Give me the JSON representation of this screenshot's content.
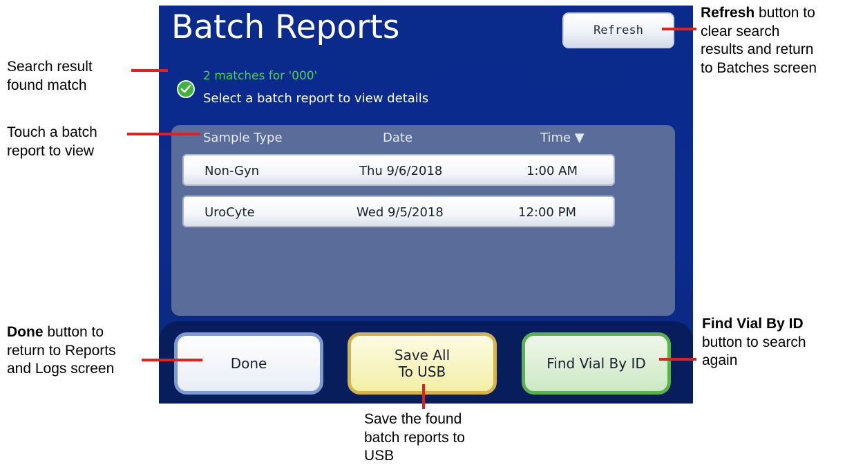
{
  "screen": {
    "title": "Batch Reports",
    "refresh_label": "Refresh",
    "match_text": "2 matches for '000'",
    "instruction": "Select a batch report to view details",
    "columns": {
      "sample_type": "Sample Type",
      "date": "Date",
      "time": "Time ▼"
    },
    "rows": [
      {
        "sample_type": "Non-Gyn",
        "date": "Thu 9/6/2018",
        "time": "1:00 AM"
      },
      {
        "sample_type": "UroCyte",
        "date": "Wed 9/5/2018",
        "time": "12:00 PM"
      }
    ],
    "done_label": "Done",
    "save_usb_line1": "Save All",
    "save_usb_line2": "To USB",
    "find_label": "Find Vial By ID"
  },
  "callouts": {
    "search_result": [
      "Search result",
      "found match"
    ],
    "touch_report": [
      "Touch a batch",
      "report to view"
    ],
    "done": {
      "bold": "Done",
      "rest1": " button to",
      "line2": "return to Reports",
      "line3": "and Logs screen"
    },
    "refresh": {
      "bold": "Refresh",
      "rest1": " button to",
      "line2": "clear search",
      "line3": "results and return",
      "line4": "to Batches screen"
    },
    "find": {
      "bold": "Find Vial By ID",
      "line2": "button to search",
      "line3": "again"
    },
    "save": [
      "Save the found",
      "batch reports to",
      "USB"
    ]
  },
  "colors": {
    "screen_bg": "#0b2c8e",
    "match_green": "#49d04a",
    "callout_line": "#e3201b"
  }
}
